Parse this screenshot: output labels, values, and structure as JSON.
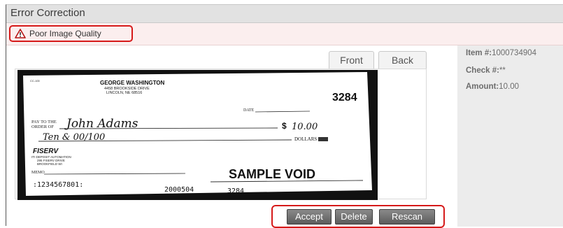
{
  "window": {
    "title": "Error Correction"
  },
  "alert": {
    "message": "Poor Image Quality",
    "icon": "warning-triangle-icon",
    "accent": "#d61a1a"
  },
  "tabs": [
    {
      "label": "Front",
      "active": true
    },
    {
      "label": "Back",
      "active": false
    }
  ],
  "check": {
    "payer_name": "GEORGE WASHINGTON",
    "payer_address1": "4458 BROOKSIDE DRIVE",
    "payer_address2": "LINCOLN, NE 68516",
    "routing_hint": "CC-100",
    "check_number": "3284",
    "date_label": "DATE",
    "payto_label1": "PAY TO THE",
    "payto_label2": "ORDER OF",
    "payee": "John Adams",
    "amount_words": "Ten & 00/100",
    "dollar_sign": "$",
    "amount_numeric": "10.00",
    "dollars_label": "DOLLARS",
    "bank_name": "FISERV",
    "bank_line1": "ITI DEPOSIT AUTOMATION",
    "bank_line2": "295 FISERV DRIVE",
    "bank_line3": "BROOKFIELD WI",
    "memo_label": "MEMO",
    "void_text": "SAMPLE VOID",
    "micr_routing": ":1234567801:",
    "micr_account": "2000504",
    "micr_check": "3284"
  },
  "actions": {
    "accept": "Accept",
    "delete": "Delete",
    "rescan": "Rescan"
  },
  "details": {
    "item_label": "Item #:",
    "item_value": "1000734904",
    "check_label": "Check #:",
    "check_value": "**",
    "amount_label": "Amount:",
    "amount_value": "10.00"
  }
}
